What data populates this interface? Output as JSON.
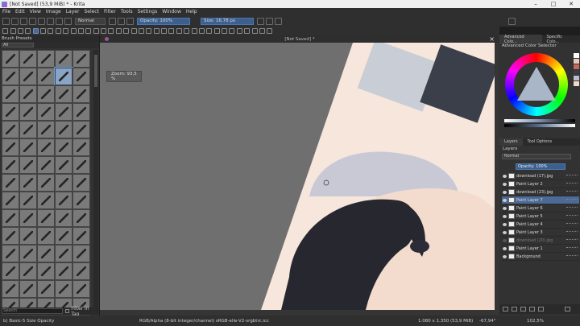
{
  "window": {
    "title": "[Not Saved]  (53,9 MiB)  * - Krita",
    "minimize": "–",
    "maximize": "□",
    "close": "✕"
  },
  "menu": [
    "File",
    "Edit",
    "View",
    "Image",
    "Layer",
    "Select",
    "Filter",
    "Tools",
    "Settings",
    "Window",
    "Help"
  ],
  "toolbar": {
    "blend_mode": "Normal",
    "opacity": "Opacity: 100%",
    "size": "Size: 16,78 px"
  },
  "brush_presets": {
    "title": "Brush Presets",
    "filter": "All",
    "search_placeholder": "Search",
    "filter_in_tag": "Filter in Tag"
  },
  "canvas": {
    "tab_title": "[Not Saved]  *",
    "zoom_label": "Zoom: 93,5 %"
  },
  "right_panel": {
    "color_tabs": [
      "Advanced Colo...",
      "Specific Colo..."
    ],
    "advanced_color_selector": "Advanced Color Selector",
    "layer_tabs": [
      "Layers",
      "Tool Options"
    ],
    "layers_title": "Layers",
    "blend_mode": "Normal",
    "opacity": "Opacity: 100%",
    "layers": [
      {
        "name": "download (17).jpg",
        "selected": false,
        "visible": true
      },
      {
        "name": "Paint Layer 2",
        "selected": false,
        "visible": true
      },
      {
        "name": "download (23).jpg",
        "selected": false,
        "visible": true
      },
      {
        "name": "Paint Layer 7",
        "selected": true,
        "visible": true
      },
      {
        "name": "Paint Layer 6",
        "selected": false,
        "visible": true
      },
      {
        "name": "Paint Layer 5",
        "selected": false,
        "visible": true
      },
      {
        "name": "Paint Layer 4",
        "selected": false,
        "visible": true
      },
      {
        "name": "Paint Layer 3",
        "selected": false,
        "visible": true
      },
      {
        "name": "download (20).jpg",
        "selected": false,
        "visible": false
      },
      {
        "name": "Paint Layer 1",
        "selected": false,
        "visible": true
      },
      {
        "name": "Background",
        "selected": false,
        "visible": true
      }
    ]
  },
  "status": {
    "brush": "b) Basic-5 Size Opacity",
    "color_space": "RGB/Alpha (8-bit integer/channel)  sRGB-elle-V2-srgbtrc.icc",
    "dimensions": "1.080 x 1.350 (53,9 MiB)",
    "rotation": "-67,94°",
    "zoom": "102,5%"
  },
  "colors": {
    "accent": "#4b6a96",
    "panel": "#323232",
    "canvas_bg": "#6f6f6f"
  }
}
